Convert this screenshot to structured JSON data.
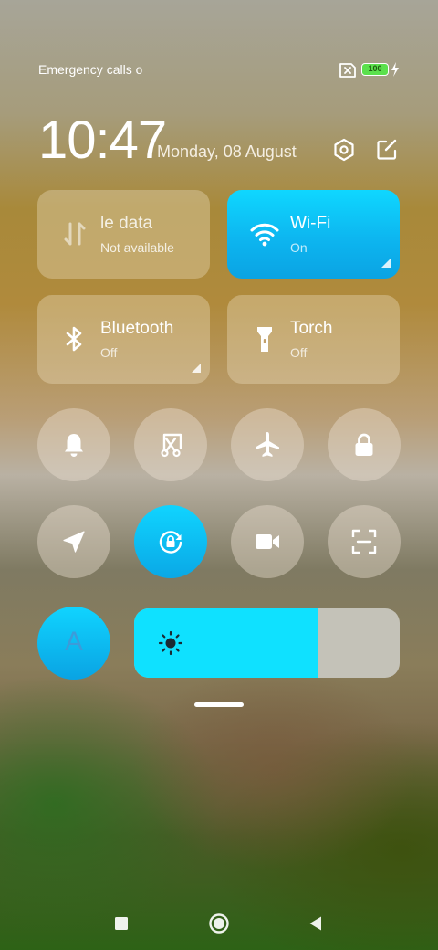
{
  "status_bar": {
    "carrier_text": "Emergency calls o",
    "battery_level": "100",
    "sim_icon": "no-sim-icon",
    "charging_icon": "bolt-icon",
    "battery_color": "#5be04c"
  },
  "header": {
    "time": "10:47",
    "date": "Monday, 08 August",
    "settings_icon": "settings-hexagon-icon",
    "edit_icon": "edit-icon"
  },
  "tiles": [
    {
      "name": "le data",
      "state": "Not available",
      "icon": "mobile-data-icon",
      "active": false
    },
    {
      "name": "Wi-Fi",
      "state": "On",
      "icon": "wifi-icon",
      "active": true
    },
    {
      "name": "Bluetooth",
      "state": "Off",
      "icon": "bluetooth-icon",
      "active": false
    },
    {
      "name": "Torch",
      "state": "Off",
      "icon": "torch-icon",
      "active": false
    }
  ],
  "toggles_row1": [
    {
      "icon": "bell-icon",
      "active": false
    },
    {
      "icon": "screenshot-icon",
      "active": false
    },
    {
      "icon": "airplane-icon",
      "active": false
    },
    {
      "icon": "lock-icon",
      "active": false
    }
  ],
  "toggles_row2": [
    {
      "icon": "location-icon",
      "active": false
    },
    {
      "icon": "rotation-lock-icon",
      "active": true
    },
    {
      "icon": "video-camera-icon",
      "active": false
    },
    {
      "icon": "scanner-icon",
      "active": false
    }
  ],
  "brightness": {
    "auto_label": "A",
    "level": 0.69,
    "icon": "sun-icon",
    "accent_color": "#0fe1ff"
  },
  "navigation": {
    "recents_icon": "square-icon",
    "home_icon": "circle-icon",
    "back_icon": "triangle-back-icon"
  }
}
